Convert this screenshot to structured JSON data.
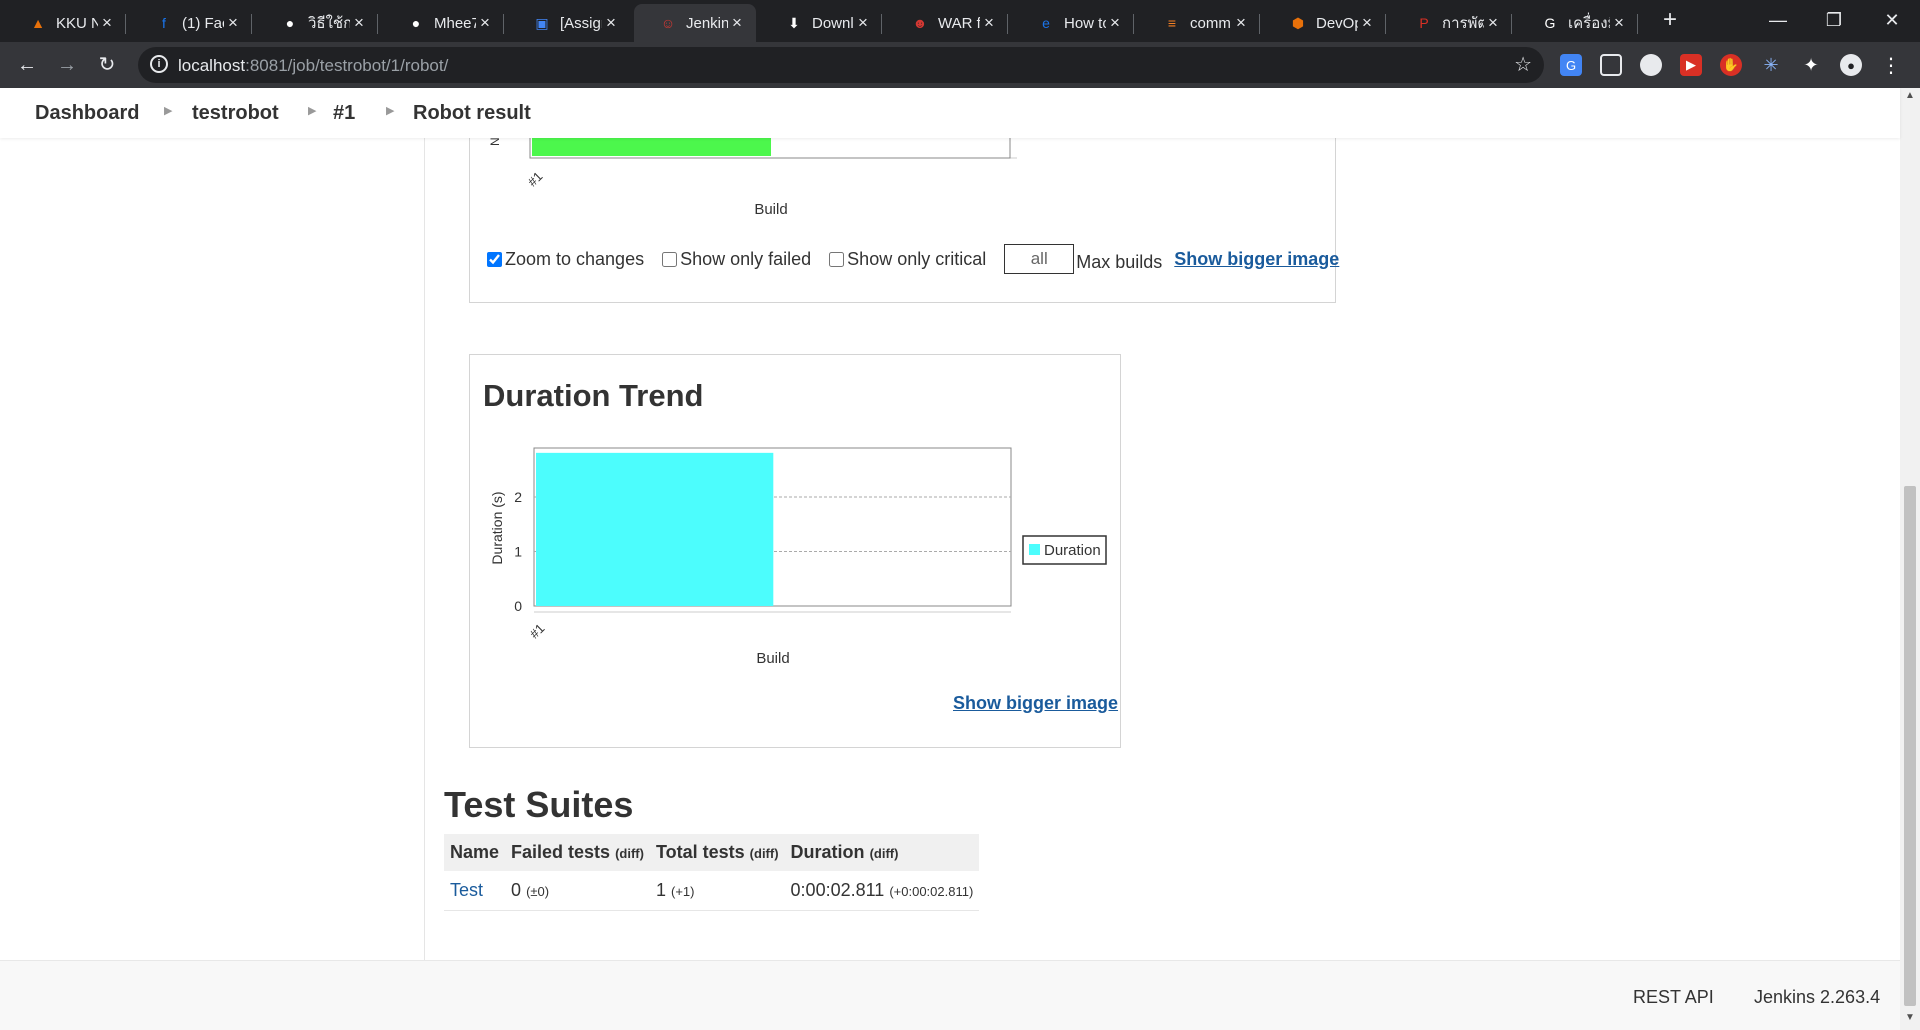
{
  "browser": {
    "tabs": [
      {
        "title": "KKU N",
        "icon": "warning-icon",
        "color": "#e8710a"
      },
      {
        "title": "(1) Fac",
        "icon": "facebook-icon",
        "color": "#1877f2"
      },
      {
        "title": "วิธีใช้ก",
        "icon": "github-icon",
        "color": "#ffffff"
      },
      {
        "title": "Mhee7",
        "icon": "github-icon",
        "color": "#ffffff"
      },
      {
        "title": "[Assign",
        "icon": "classroom-icon",
        "color": "#4285f4"
      },
      {
        "title": "Jenkins",
        "icon": "jenkins-icon",
        "color": "#d33833"
      },
      {
        "title": "Downl",
        "icon": "download-icon",
        "color": "#ffffff"
      },
      {
        "title": "WAR fi",
        "icon": "person-icon",
        "color": "#d33833"
      },
      {
        "title": "How to",
        "icon": "e-icon",
        "color": "#1a73e8"
      },
      {
        "title": "comm",
        "icon": "stackoverflow-icon",
        "color": "#f48024"
      },
      {
        "title": "DevOp",
        "icon": "cube-icon",
        "color": "#e8710a"
      },
      {
        "title": "การพัฒ",
        "icon": "bookmark-icon",
        "color": "#d93025"
      },
      {
        "title": "เครื่องมื",
        "icon": "google-icon",
        "color": "#ffffff"
      }
    ],
    "url_host": "localhost",
    "url_path": ":8081/job/testrobot/1/robot/"
  },
  "breadcrumbs": {
    "items": [
      "Dashboard",
      "testrobot",
      "#1",
      "Robot result"
    ]
  },
  "status_chart": {
    "options": {
      "zoom_label": "Zoom to changes",
      "failed_label": "Show only failed",
      "critical_label": "Show only critical",
      "max_builds_value": "all",
      "max_builds_label": "Max builds",
      "bigger_image_label": "Show bigger image"
    },
    "zoom_checked": true,
    "failed_checked": false,
    "critical_checked": false
  },
  "chart_data": [
    {
      "type": "bar",
      "title": "",
      "xlabel": "Build",
      "ylabel": "N",
      "categories": [
        "#1"
      ],
      "series": [
        {
          "values": [
            1
          ],
          "color": "#4cf74c"
        }
      ]
    },
    {
      "type": "bar",
      "title": "Duration Trend",
      "xlabel": "Build",
      "ylabel": "Duration (s)",
      "categories": [
        "#1"
      ],
      "yticks": [
        0,
        1,
        2
      ],
      "ylim": [
        0,
        2.9
      ],
      "grid": true,
      "legend": "right",
      "series": [
        {
          "name": "Duration",
          "values": [
            2.811
          ],
          "color": "#4cfdfd"
        }
      ]
    }
  ],
  "duration_panel": {
    "bigger_image_label": "Show bigger image"
  },
  "test_suites": {
    "title": "Test Suites",
    "headers": [
      {
        "label": "Name",
        "diff": ""
      },
      {
        "label": "Failed tests",
        "diff": "(diff)"
      },
      {
        "label": "Total tests",
        "diff": "(diff)"
      },
      {
        "label": "Duration",
        "diff": "(diff)"
      }
    ],
    "rows": [
      {
        "name": "Test",
        "failed": "0",
        "failed_diff": "(±0)",
        "total": "1",
        "total_diff": "(+1)",
        "duration": "0:00:02.811",
        "duration_diff": "(+0:00:02.811)"
      }
    ]
  },
  "footer": {
    "rest_api": "REST API",
    "version": "Jenkins 2.263.4"
  }
}
